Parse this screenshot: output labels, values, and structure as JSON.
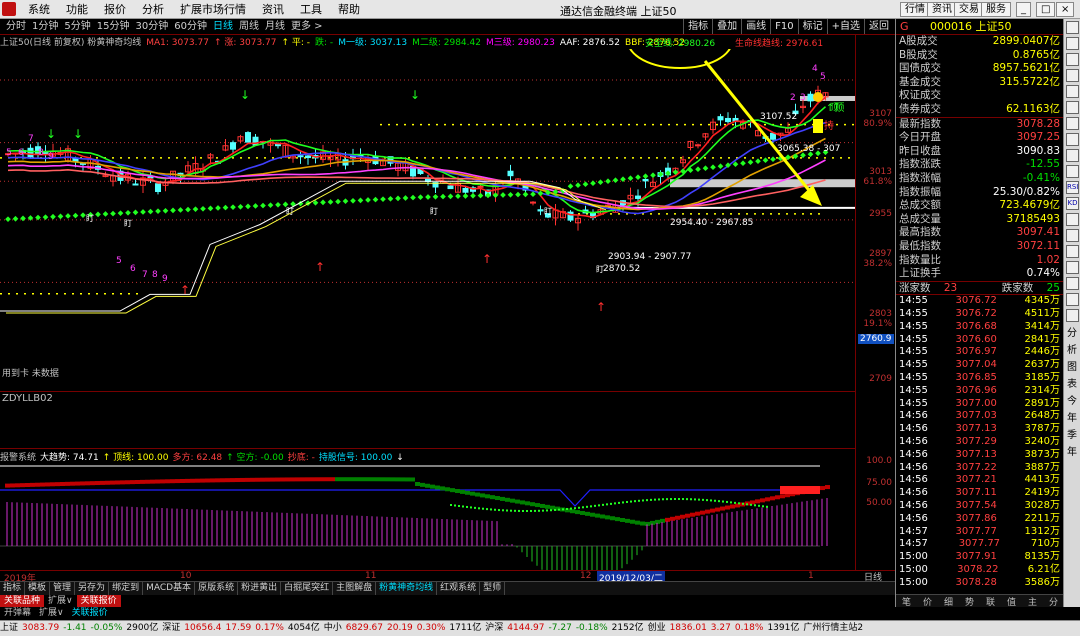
{
  "menubar": {
    "items": [
      "系统",
      "功能",
      "报价",
      "分析",
      "扩展市场行情",
      "资讯",
      "工具",
      "帮助"
    ],
    "title": "通达信金融终端   上证50",
    "right": [
      "行情",
      "资讯",
      "交易",
      "服务"
    ]
  },
  "tabbar": {
    "tabs": [
      "分时",
      "1分钟",
      "5分钟",
      "15分钟",
      "30分钟",
      "60分钟",
      "日线",
      "周线",
      "月线",
      "更多 >"
    ],
    "active": 6,
    "tools": [
      "指标",
      "叠加",
      "画线",
      "F10",
      "标记",
      "+自选",
      "返回"
    ]
  },
  "infobar": [
    {
      "t": "上证50(日线 前复权) 粉黄神奇均线",
      "c": "gry"
    },
    {
      "t": "MA1: 3073.77",
      "c": "red"
    },
    {
      "t": "↑ 涨: 3073.77",
      "c": "red"
    },
    {
      "t": "↑ 平: -",
      "c": "yel"
    },
    {
      "t": "跌: -",
      "c": "grn"
    },
    {
      "t": "M一级: 3037.13",
      "c": "cyn"
    },
    {
      "t": "M二级: 2984.42",
      "c": "grn"
    },
    {
      "t": "M三级: 2980.23",
      "c": "mag"
    },
    {
      "t": "AAF: 2876.52",
      "c": "wht"
    },
    {
      "t": "BBF: 2876.52",
      "c": "yel"
    }
  ],
  "overlay": {
    "safe": "安全线: 2980.26",
    "life": "生命线趋线: 2976.61",
    "p3107": "3107.52",
    "p3065": "3065.38 - 307",
    "p2954": "2954.40 - 2967.85",
    "p2903": "2903.94 - 2907.77",
    "p2870": "2870.52",
    "hold": "持",
    "wave": "↑顶",
    "noData": "用到卡 未数据",
    "leftNums": [
      "5",
      "7",
      "6",
      "8",
      "9"
    ],
    "ding": "顶"
  },
  "axis": {
    "price": [
      {
        "v": "3107",
        "p": "80.9%"
      },
      {
        "v": "3013",
        "p": "61.8%"
      },
      {
        "v": "2955",
        "p": ""
      },
      {
        "v": "2897",
        "p": "38.2%"
      },
      {
        "v": "2803",
        "p": "19.1%"
      },
      {
        "v": "2709",
        "p": ""
      }
    ],
    "current": "2760.9",
    "ind": [
      "100.0",
      "75.00",
      "50.00"
    ],
    "dates": [
      "2019年",
      "10",
      "11",
      "12",
      "2019/12/03/二",
      "1"
    ],
    "dayline": "日线"
  },
  "ind1": {
    "name": "ZDYLLB02"
  },
  "ind2hdr": [
    {
      "t": "报警系统",
      "c": "gry"
    },
    {
      "t": "大趋势: 74.71",
      "c": "wht"
    },
    {
      "t": "↑ 顶线: 100.00",
      "c": "yel"
    },
    {
      "t": "多方: 62.48",
      "c": "red"
    },
    {
      "t": "↑ 空方: -0.00",
      "c": "grn"
    },
    {
      "t": "抄底: -",
      "c": "red"
    },
    {
      "t": "持股信号: 100.00",
      "c": "cyn"
    },
    {
      "t": "↓",
      "c": "wht"
    }
  ],
  "bottomtabs": {
    "items": [
      "指标",
      "模板",
      "管理",
      "另存为",
      "绑定到",
      "MACD基本",
      "原版系统",
      "粉进黄出",
      "白掘尾突红",
      "主图解盘",
      "粉黄神奇均线",
      "红观系统",
      "型师"
    ],
    "active": 10
  },
  "linkbar": {
    "items": [
      "关联品种",
      "扩展∨",
      "关联报价"
    ]
  },
  "statbar2": {
    "items": [
      "开弹幕",
      "扩展∨",
      "关联报价"
    ]
  },
  "statusbar": [
    {
      "t": "上证",
      "c": "gry"
    },
    {
      "t": "3083.79",
      "c": "red"
    },
    {
      "t": "-1.41",
      "c": "grn"
    },
    {
      "t": "-0.05%",
      "c": "grn"
    },
    {
      "t": "2900亿",
      "c": "gry"
    },
    {
      "t": "深证",
      "c": "gry"
    },
    {
      "t": "10656.4",
      "c": "red"
    },
    {
      "t": "17.59",
      "c": "red"
    },
    {
      "t": "0.17%",
      "c": "red"
    },
    {
      "t": "4054亿",
      "c": "gry"
    },
    {
      "t": "中小",
      "c": "gry"
    },
    {
      "t": "6829.67",
      "c": "red"
    },
    {
      "t": "20.19",
      "c": "red"
    },
    {
      "t": "0.30%",
      "c": "red"
    },
    {
      "t": "1711亿",
      "c": "gry"
    },
    {
      "t": "沪深",
      "c": "gry"
    },
    {
      "t": "4144.97",
      "c": "red"
    },
    {
      "t": "-7.27",
      "c": "grn"
    },
    {
      "t": "-0.18%",
      "c": "grn"
    },
    {
      "t": "2152亿",
      "c": "gry"
    },
    {
      "t": "创业",
      "c": "gry"
    },
    {
      "t": "1836.01",
      "c": "red"
    },
    {
      "t": "3.27",
      "c": "red"
    },
    {
      "t": "0.18%",
      "c": "red"
    },
    {
      "t": "1391亿",
      "c": "gry"
    },
    {
      "t": "广州行情主站2",
      "c": "gry"
    }
  ],
  "rpanel": {
    "code": "G",
    "title": "000016 上证50",
    "stats": [
      {
        "k": "A股成交",
        "v": "2899.0407亿",
        "c": "yel"
      },
      {
        "k": "B股成交",
        "v": "0.8765亿",
        "c": "yel"
      },
      {
        "k": "国债成交",
        "v": "8957.5621亿",
        "c": "yel"
      },
      {
        "k": "基金成交",
        "v": "315.5722亿",
        "c": "yel"
      },
      {
        "k": "权证成交",
        "v": "",
        "c": "yel"
      },
      {
        "k": "债券成交",
        "v": "62.1163亿",
        "c": "yel"
      }
    ],
    "quotes": [
      {
        "k": "最新指数",
        "v": "3078.28",
        "c": "red"
      },
      {
        "k": "今日开盘",
        "v": "3097.25",
        "c": "red"
      },
      {
        "k": "昨日收盘",
        "v": "3090.83",
        "c": "wht"
      },
      {
        "k": "指数涨跌",
        "v": "-12.55",
        "c": "grn"
      },
      {
        "k": "指数涨幅",
        "v": "-0.41%",
        "c": "grn"
      },
      {
        "k": "指数振幅",
        "v": "25.30/0.82%",
        "c": "wht"
      },
      {
        "k": "总成交额",
        "v": "723.4679亿",
        "c": "yel"
      },
      {
        "k": "总成交量",
        "v": "37185493",
        "c": "yel"
      },
      {
        "k": "最高指数",
        "v": "3097.41",
        "c": "red"
      },
      {
        "k": "最低指数",
        "v": "3072.11",
        "c": "red"
      },
      {
        "k": "指数量比",
        "v": "1.02",
        "c": "red"
      },
      {
        "k": "上证换手",
        "v": "0.74%",
        "c": "wht"
      }
    ],
    "updown": {
      "k1": "涨家数",
      "v1": "23",
      "k2": "跌家数",
      "v2": "25"
    },
    "trades": [
      {
        "t": "14:55",
        "p": "3076.72",
        "v": "4345万"
      },
      {
        "t": "14:55",
        "p": "3076.72",
        "v": "4511万"
      },
      {
        "t": "14:55",
        "p": "3076.68",
        "v": "3414万"
      },
      {
        "t": "14:55",
        "p": "3076.60",
        "v": "2841万"
      },
      {
        "t": "14:55",
        "p": "3076.97",
        "v": "2446万"
      },
      {
        "t": "14:55",
        "p": "3077.04",
        "v": "2637万"
      },
      {
        "t": "14:55",
        "p": "3076.85",
        "v": "3185万"
      },
      {
        "t": "14:55",
        "p": "3076.96",
        "v": "2314万"
      },
      {
        "t": "14:55",
        "p": "3077.00",
        "v": "2891万"
      },
      {
        "t": "14:56",
        "p": "3077.03",
        "v": "2648万"
      },
      {
        "t": "14:56",
        "p": "3077.13",
        "v": "3787万"
      },
      {
        "t": "14:56",
        "p": "3077.29",
        "v": "3240万"
      },
      {
        "t": "14:56",
        "p": "3077.13",
        "v": "3873万"
      },
      {
        "t": "14:56",
        "p": "3077.22",
        "v": "3887万"
      },
      {
        "t": "14:56",
        "p": "3077.21",
        "v": "4413万"
      },
      {
        "t": "14:56",
        "p": "3077.11",
        "v": "2419万"
      },
      {
        "t": "14:56",
        "p": "3077.54",
        "v": "3028万"
      },
      {
        "t": "14:56",
        "p": "3077.86",
        "v": "2211万"
      },
      {
        "t": "14:57",
        "p": "3077.77",
        "v": "1312万"
      },
      {
        "t": "14:57",
        "p": "3077.77",
        "v": "710万"
      },
      {
        "t": "15:00",
        "p": "3077.91",
        "v": "8135万"
      },
      {
        "t": "15:00",
        "p": "3078.22",
        "v": "6.21亿"
      },
      {
        "t": "15:00",
        "p": "3078.28",
        "v": "3586万"
      }
    ],
    "ptabs": [
      "笔",
      "价",
      "细",
      "势",
      "联",
      "值",
      "主",
      "分"
    ]
  },
  "vtools": {
    "chars": [
      "分",
      "析",
      "图",
      "表"
    ],
    "yearchars": [
      "今",
      "年",
      "季",
      "年"
    ]
  }
}
